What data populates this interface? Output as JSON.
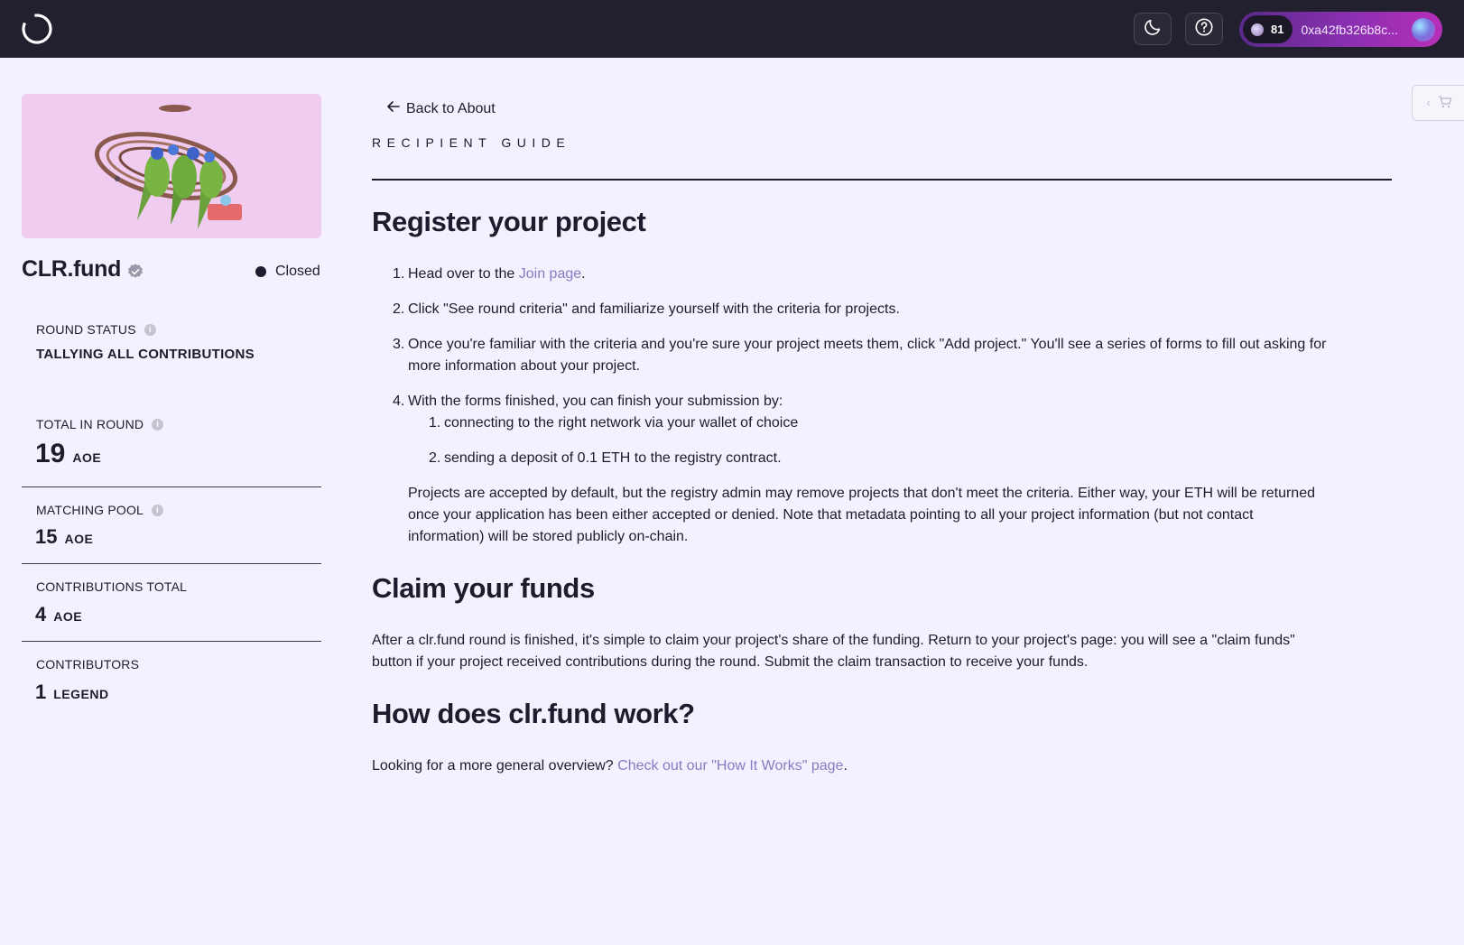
{
  "nav": {
    "wallet_balance": "81",
    "wallet_address": "0xa42fb326b8c..."
  },
  "sidebar": {
    "round_name": "CLR.fund",
    "round_state": "Closed",
    "round_status_label": "ROUND STATUS",
    "round_status_value": "TALLYING ALL CONTRIBUTIONS",
    "stats": [
      {
        "label": "TOTAL IN ROUND",
        "value": "19",
        "unit": "AOE"
      },
      {
        "label": "MATCHING POOL",
        "value": "15",
        "unit": "AOE"
      },
      {
        "label": "CONTRIBUTIONS TOTAL",
        "value": "4",
        "unit": "AOE"
      },
      {
        "label": "CONTRIBUTORS",
        "value": "1",
        "unit": "LEGEND"
      }
    ]
  },
  "main": {
    "back_link": "Back to About",
    "eyebrow": "RECIPIENT GUIDE",
    "register": {
      "heading": "Register your project",
      "step1_pre": "Head over to the ",
      "step1_link": "Join page",
      "step1_post": ".",
      "step2": "Click \"See round criteria\" and familiarize yourself with the criteria for projects.",
      "step3_line1": "Once you're familiar with the criteria and you're sure your project meets them, click \"Add project.\" You'll see a series of forms to fill out asking for",
      "step3_line2": "more information about your project.",
      "step4": "With the forms finished, you can finish your submission by:",
      "step4_sub1": "connecting to the right network via your wallet of choice",
      "step4_sub2": "sending a deposit of 0.1 ETH to the registry contract.",
      "note_line1": "Projects are accepted by default, but the registry admin may remove projects that don't meet the criteria. Either way, your ETH will be returned",
      "note_line2": "once your application has been either accepted or denied. Note that metadata pointing to all your project information (but not contact",
      "note_line3": "information) will be stored publicly on-chain."
    },
    "claim": {
      "heading": "Claim your funds",
      "line1": "After a clr.fund round is finished, it's simple to claim your project's share of the funding. Return to your project's page: you will see a \"claim funds\"",
      "line2": "button if your project received contributions during the round. Submit the claim transaction to receive your funds."
    },
    "how": {
      "heading": "How does clr.fund work?",
      "pre": "Looking for a more general overview? ",
      "link": "Check out our \"How It Works\" page",
      "post": "."
    }
  },
  "colors": {
    "nav_bg": "#221f2e",
    "page_bg": "#f3f1fd",
    "link": "#8b79c4",
    "wallet_gradient_start": "#5a2a8a",
    "wallet_gradient_end": "#b62fb8"
  }
}
